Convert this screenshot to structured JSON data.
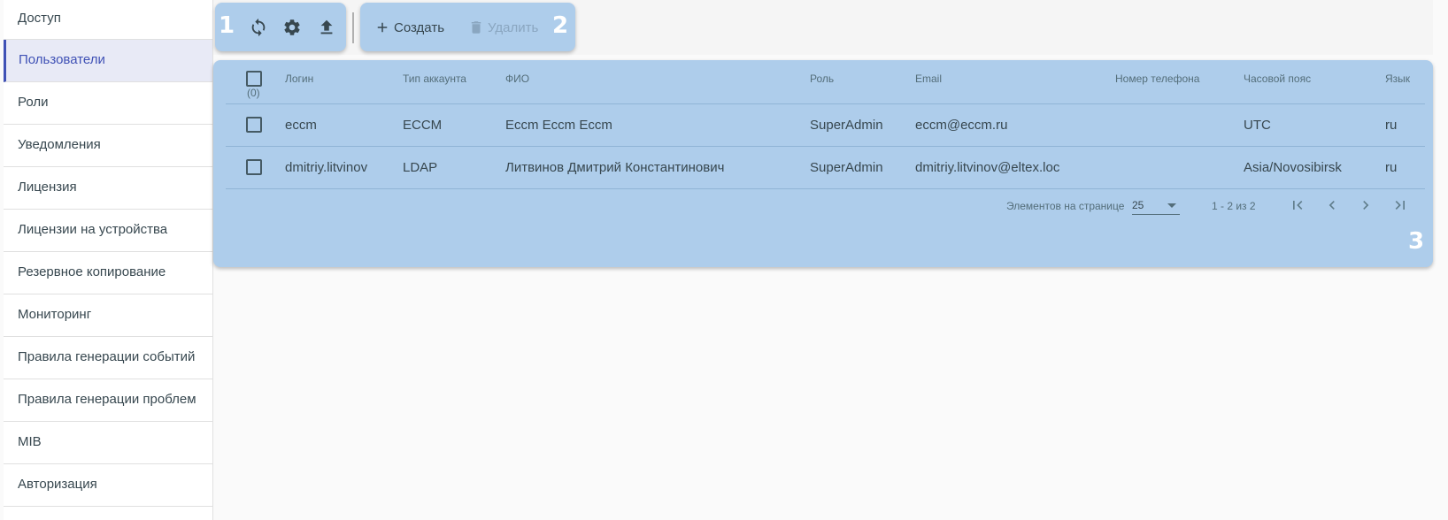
{
  "sidebar": {
    "items": [
      {
        "label": "Доступ"
      },
      {
        "label": "Пользователи"
      },
      {
        "label": "Роли"
      },
      {
        "label": "Уведомления"
      },
      {
        "label": "Лицензия"
      },
      {
        "label": "Лицензии на устройства"
      },
      {
        "label": "Резервное копирование"
      },
      {
        "label": "Мониторинг"
      },
      {
        "label": "Правила генерации событий"
      },
      {
        "label": "Правила генерации проблем"
      },
      {
        "label": "MIB"
      },
      {
        "label": "Авторизация"
      }
    ],
    "active_index": 1
  },
  "toolbar": {
    "marker1": "1",
    "marker2": "2",
    "create_label": "Создать",
    "delete_label": "Удалить",
    "icons": [
      "refresh-icon",
      "gear-icon",
      "upload-icon",
      "plus-icon",
      "trash-icon"
    ]
  },
  "table": {
    "marker3": "3",
    "select_count": "(0)",
    "columns": {
      "login": "Логин",
      "account_type": "Тип аккаунта",
      "fio": "ФИО",
      "role": "Роль",
      "email": "Email",
      "phone": "Номер телефона",
      "timezone": "Часовой пояс",
      "language": "Язык"
    },
    "rows": [
      {
        "login": "eccm",
        "account_type": "ECCM",
        "fio": "Eccm Eccm Eccm",
        "role": "SuperAdmin",
        "email": "eccm@eccm.ru",
        "phone": "",
        "timezone": "UTC",
        "language": "ru"
      },
      {
        "login": "dmitriy.litvinov",
        "account_type": "LDAP",
        "fio": "Литвинов Дмитрий Константинович",
        "role": "SuperAdmin",
        "email": "dmitriy.litvinov@eltex.loc",
        "phone": "",
        "timezone": "Asia/Novosibirsk",
        "language": "ru"
      }
    ]
  },
  "pager": {
    "items_per_page_label": "Элементов на странице",
    "page_size": "25",
    "range": "1 - 2 из 2"
  },
  "colors": {
    "highlight": "#aecdeb",
    "accent": "#3f51b5"
  }
}
